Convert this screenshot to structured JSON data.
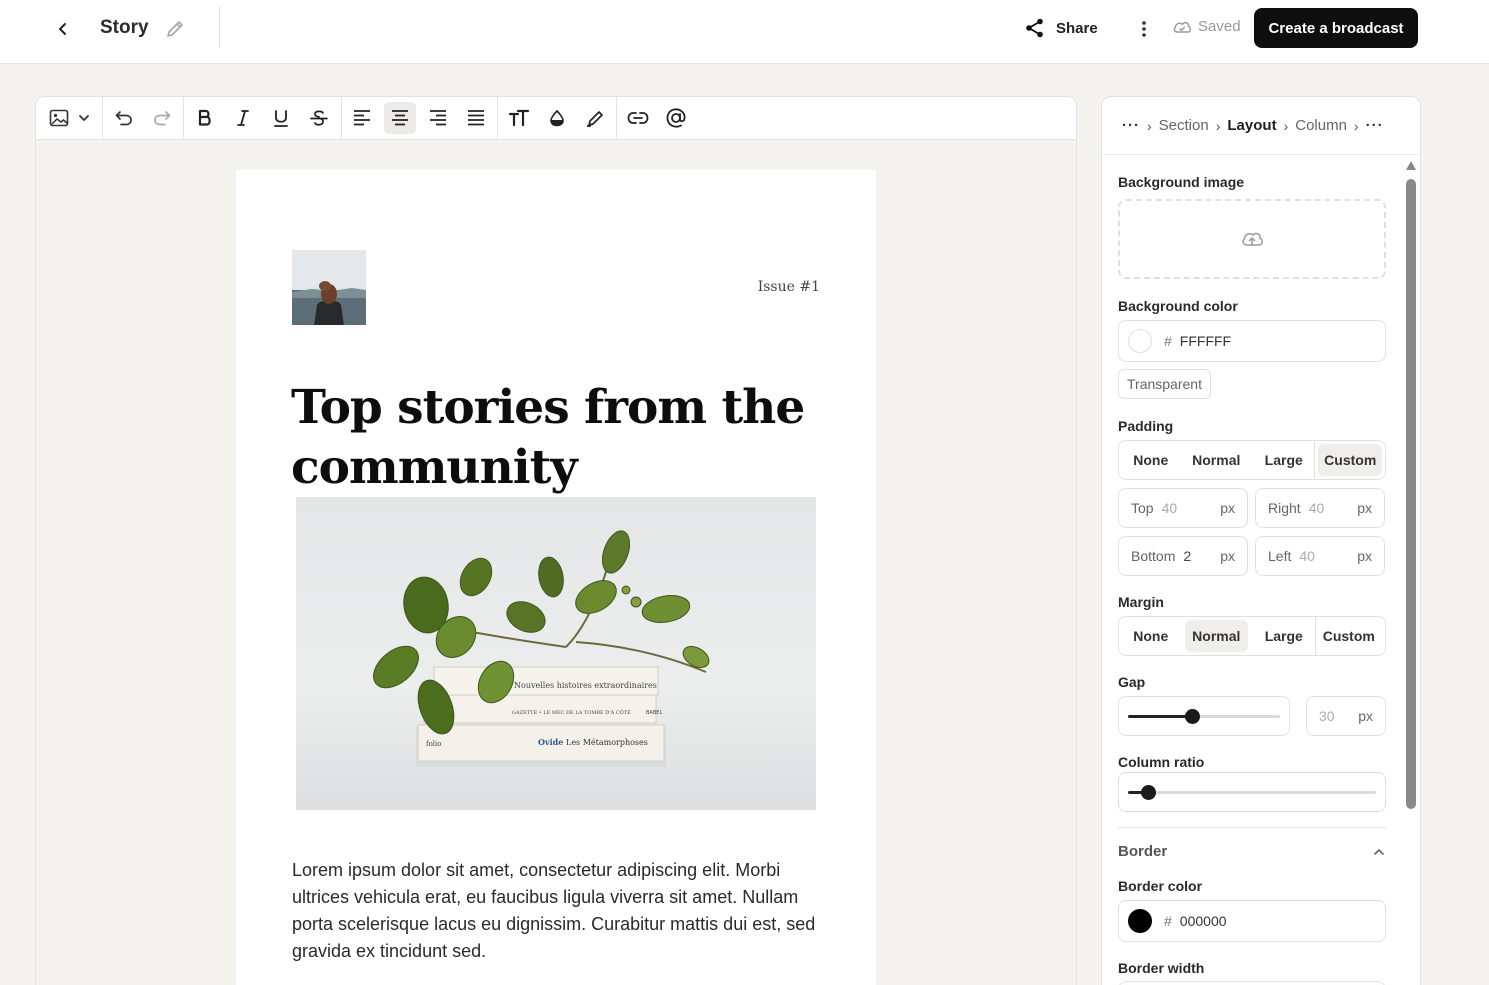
{
  "header": {
    "title": "Story",
    "share_label": "Share",
    "saved_label": "Saved",
    "create_label": "Create a broadcast"
  },
  "toolbar": {
    "icons": [
      "image-icon",
      "chevron-down-icon",
      "undo-icon",
      "redo-icon",
      "bold-icon",
      "italic-icon",
      "underline-icon",
      "strikethrough-icon",
      "align-left-icon",
      "align-center-icon",
      "align-right-icon",
      "align-justify-icon",
      "text-size-icon",
      "text-color-icon",
      "highlight-icon",
      "link-icon",
      "mention-icon"
    ],
    "active": "align-center-icon"
  },
  "document": {
    "issue": "Issue #1",
    "headline": "Top stories from the community",
    "body": "Lorem ipsum dolor sit amet, consectetur adipiscing elit. Morbi ultrices vehicula erat, eu faucibus ligula viverra sit amet. Nullam porta scelerisque lacus eu dignissim. Curabitur mattis dui est, sed gravida ex tincidunt sed.",
    "hero_books": [
      "Nouvelles histoires extraordinaires",
      "GAZETTE • LE MEC DE LA TOMBE D'À CÔTÉ",
      "BABEL",
      "folio",
      "Ovide",
      "Les Métamorphoses"
    ]
  },
  "panel": {
    "breadcrumbs": [
      "Section",
      "Layout",
      "Column"
    ],
    "current_crumb": "Layout",
    "background_image_label": "Background image",
    "background_color_label": "Background color",
    "background_color_value": "FFFFFF",
    "hash": "#",
    "transparent_label": "Transparent",
    "padding_label": "Padding",
    "padding_options": [
      "None",
      "Normal",
      "Large",
      "Custom"
    ],
    "padding_selected": "Custom",
    "padding": {
      "top_label": "Top",
      "top_value": "40",
      "right_label": "Right",
      "right_value": "40",
      "bottom_label": "Bottom",
      "bottom_value": "2",
      "left_label": "Left",
      "left_value": "40",
      "unit": "px"
    },
    "margin_label": "Margin",
    "margin_options": [
      "None",
      "Normal",
      "Large",
      "Custom"
    ],
    "margin_selected": "Normal",
    "gap_label": "Gap",
    "gap_value": "30",
    "gap_unit": "px",
    "gap_level": 0.42,
    "column_ratio_label": "Column ratio",
    "column_ratio_level": 0.08,
    "border_section_label": "Border",
    "border_color_label": "Border color",
    "border_color_value": "000000",
    "border_width_label": "Border width"
  },
  "colors": {
    "primary_button": "#0e0e0e",
    "background": "#f4f3ef",
    "border_swatch": "#000000",
    "bg_swatch": "#ffffff"
  }
}
